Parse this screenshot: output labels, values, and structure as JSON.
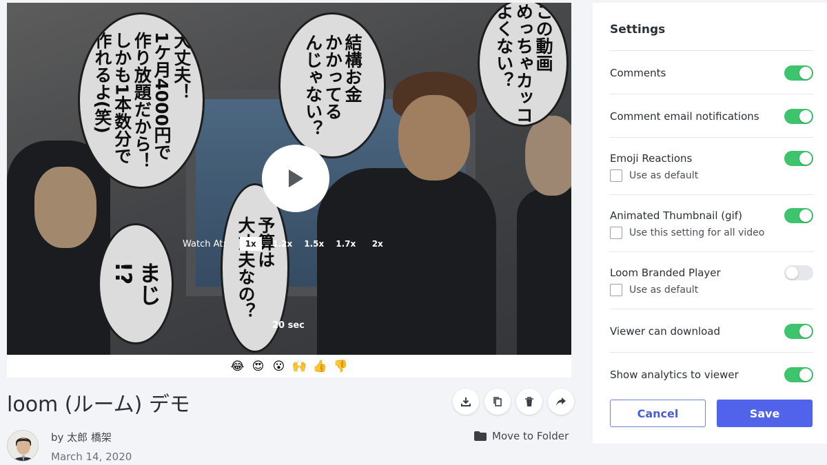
{
  "video": {
    "bubbles": [
      "大丈夫！\n1ケ月4000円で\n作り放題だから！\nしかも1本数分で\n作れるよ(笑)",
      "結構お金\nかかってる\nんじゃない？",
      "この動画\nめっちゃカッコ\nよくない？",
      "まじ\n!?",
      "予算は\n大丈夫なの？"
    ],
    "watch_at_label": "Watch At:",
    "speeds": [
      "1x",
      "1.2x",
      "1.5x",
      "1.7x",
      "2x"
    ],
    "selected_speed": "1x",
    "duration": "20 sec",
    "reactions": [
      "😂",
      "😍",
      "😮",
      "🙌",
      "👍",
      "👎"
    ]
  },
  "details": {
    "title": "loom (ルーム) デモ",
    "author": "by 太郎 橋架",
    "date": "March 14, 2020",
    "move_to_folder": "Move to Folder",
    "actions": [
      "download-icon",
      "copy-icon",
      "trash-icon",
      "share-icon"
    ]
  },
  "settings": {
    "title": "Settings",
    "items": [
      {
        "label": "Comments",
        "on": true
      },
      {
        "label": "Comment email notifications",
        "on": true
      },
      {
        "label": "Emoji Reactions",
        "on": true,
        "checkbox": "Use as default",
        "checked": false
      },
      {
        "label": "Animated Thumbnail (gif)",
        "on": true,
        "checkbox": "Use this setting for all video",
        "checked": false
      },
      {
        "label": "Loom Branded Player",
        "on": false,
        "checkbox": "Use as default",
        "checked": false
      },
      {
        "label": "Viewer can download",
        "on": true
      },
      {
        "label": "Show analytics to viewer",
        "on": true
      }
    ],
    "cancel_label": "Cancel",
    "save_label": "Save"
  },
  "colors": {
    "accent": "#5063ea",
    "toggle_on": "#3ec46d",
    "toggle_off": "#e5e7ea"
  }
}
